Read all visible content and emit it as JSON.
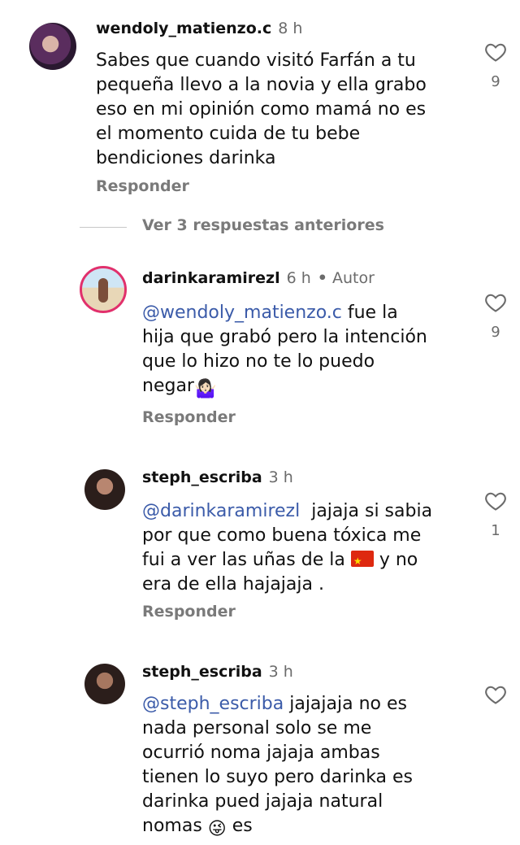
{
  "more_replies": "Ver 3 respuestas anteriores",
  "comments": [
    {
      "username": "wendoly_matienzo.c",
      "time": "8 h",
      "lines": [
        "Sabes que cuando visitó Farfán a tu",
        "pequeña llevo a la novia y ella grabo",
        "eso en mi opinión como mamá no es",
        "el momento cuida de tu bebe",
        "bendiciones darinka"
      ],
      "reply_label": "Responder",
      "likes": "9"
    },
    {
      "username": "darinkaramirezl",
      "time": "6 h",
      "author_label": "Autor",
      "mention": "@wendoly_matienzo.c",
      "line1_rest": " fue la",
      "lines": [
        "hija que grabó pero la intención",
        "que lo hizo no te lo puedo"
      ],
      "last_line": "negar",
      "emoji": "🤷🏻‍♀️",
      "reply_label": "Responder",
      "likes": "9"
    },
    {
      "username": "steph_escriba",
      "time": "3 h",
      "mention": "@darinkaramirezl",
      "line1_rest": "  jajaja si sabia",
      "lines": [
        "por que como buena tóxica me"
      ],
      "line3_start": "fui a ver las uñas de la ",
      "line3_end": " y no",
      "line4": "era de ella hajajaja .",
      "reply_label": "Responder",
      "likes": "1"
    },
    {
      "username": "steph_escriba",
      "time": "3 h",
      "mention": "@steph_escriba",
      "line1_rest": " jajajaja no es",
      "lines": [
        "nada personal solo se me",
        "ocurrió noma jajaja ambas",
        "tienen lo suyo pero darinka es",
        "darinka pued jajaja natural"
      ],
      "last_line": "nomas ",
      "emoji": "😜",
      "last_line_end": " es"
    }
  ],
  "colors": {
    "mention": "#3b5ba9",
    "muted": "#7a7a7a",
    "author_ring": "#e1306c"
  },
  "icons": [
    "heart-icon",
    "flag-cn-icon"
  ]
}
